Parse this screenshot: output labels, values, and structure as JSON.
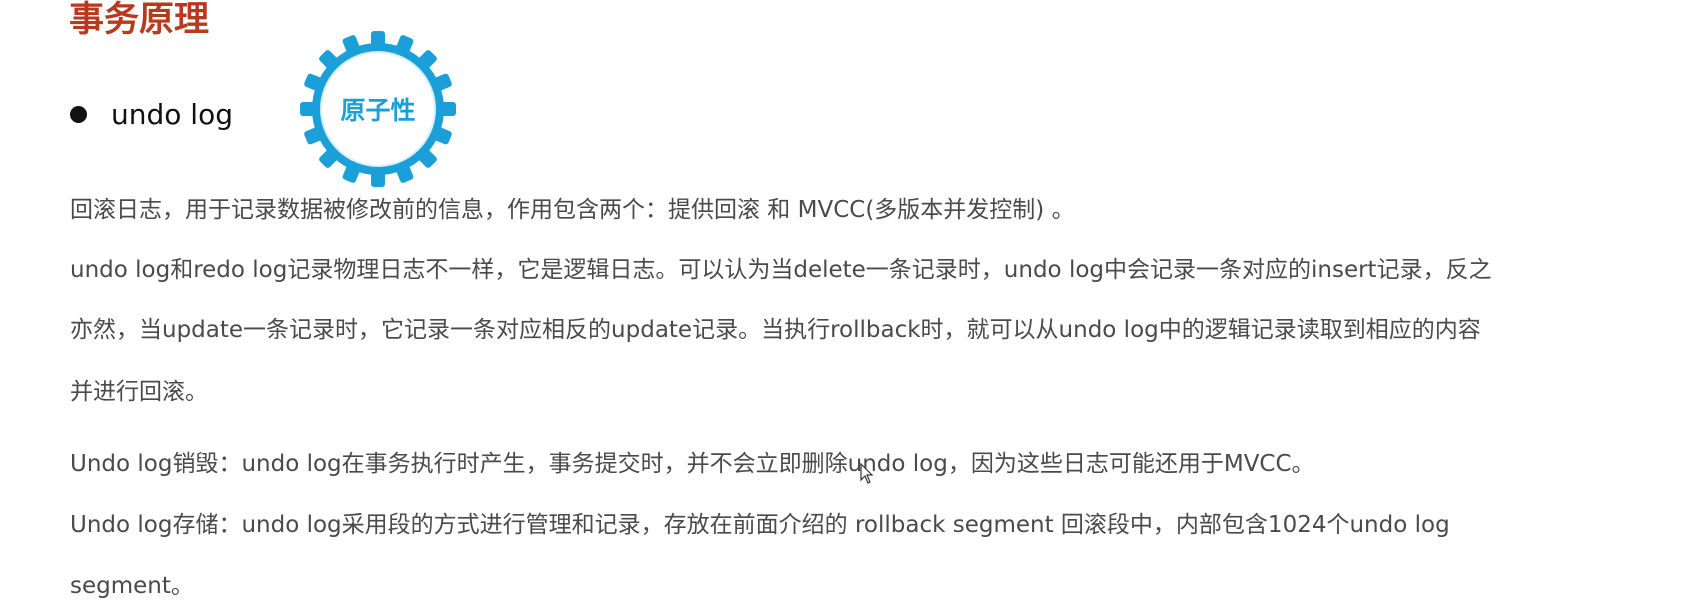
{
  "heading": {
    "title": "事务原理"
  },
  "bullet": {
    "label": "undo log"
  },
  "badge": {
    "label": "原子性",
    "color": "#1a9fd9"
  },
  "paragraphs": {
    "p1": "回滚日志，用于记录数据被修改前的信息，作用包含两个：提供回滚 和 MVCC(多版本并发控制) 。",
    "p2_line1": "undo log和redo log记录物理日志不一样，它是逻辑日志。可以认为当delete一条记录时，undo log中会记录一条对应的insert记录，反之",
    "p2_line2": "亦然，当update一条记录时，它记录一条对应相反的update记录。当执行rollback时，就可以从undo log中的逻辑记录读取到相应的内容",
    "p2_line3": "并进行回滚。",
    "p3": "Undo log销毁：undo log在事务执行时产生，事务提交时，并不会立即删除undo log，因为这些日志可能还用于MVCC。",
    "p4_line1": "Undo log存储：undo log采用段的方式进行管理和记录，存放在前面介绍的 rollback segment 回滚段中，内部包含1024个undo log",
    "p4_line2": "segment。"
  },
  "colors": {
    "title": "#b83a1e",
    "body_text": "#4a4a4a",
    "gear_blue": "#1a9fd9"
  }
}
